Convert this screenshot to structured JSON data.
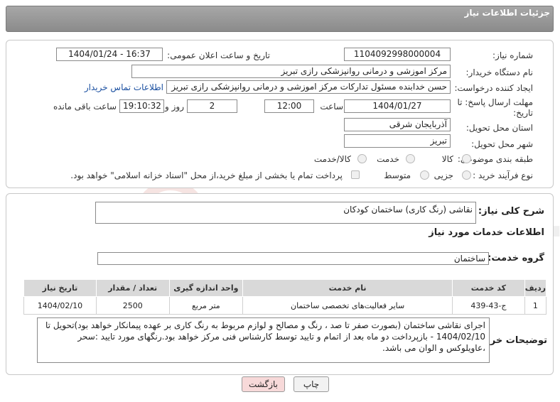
{
  "header": {
    "title": "جزئیات اطلاعات نیاز"
  },
  "fields": {
    "need_number_label": "شماره نیاز:",
    "need_number": "1104092998000004",
    "announce_label": "تاریخ و ساعت اعلان عمومی:",
    "announce_value": "1404/01/24 - 16:37",
    "buyer_org_label": "نام دستگاه خریدار:",
    "buyer_org": "مرکز اموزشی و درمانی روانپزشکی رازی تبریز",
    "creator_label": "ایجاد کننده درخواست:",
    "creator": "حسن خدابنده مسئول تدارکات مرکز اموزشی و درمانی روانپزشکی رازی تبریز",
    "contact_link": "اطلاعات تماس خریدار",
    "deadline_label": "مهلت ارسال پاسخ: تا تاریخ:",
    "deadline_date": "1404/01/27",
    "time_label": "ساعت",
    "deadline_time": "12:00",
    "days_value": "2",
    "days_label": "روز و",
    "remaining_time": "19:10:32",
    "remaining_label": "ساعت باقی مانده",
    "province_label": "استان محل تحویل:",
    "province": "آذربایجان شرقی",
    "city_label": "شهر محل تحویل:",
    "city": "تبریز",
    "category_label": "طبقه بندی موضوعی:",
    "category_options": [
      "کالا",
      "خدمت",
      "کالا/خدمت"
    ],
    "process_label": "نوع فرآیند خرید :",
    "process_options": [
      "جزیی",
      "متوسط"
    ],
    "payment_note": "پرداخت تمام یا بخشی از مبلغ خرید،از محل \"اسناد خزانه اسلامی\" خواهد بود."
  },
  "summary": {
    "label": "شرح کلی نیاز:",
    "value": "نقاشی (رنگ کاری) ساختمان کودکان"
  },
  "services": {
    "section_title": "اطلاعات خدمات مورد نیاز",
    "group_label": "گروه خدمت:",
    "group_value": "ساختمان",
    "columns": [
      "ردیف",
      "کد خدمت",
      "نام خدمت",
      "واحد اندازه گیری",
      "تعداد / مقدار",
      "تاریخ نیاز"
    ],
    "rows": [
      [
        "1",
        "ج-43-439",
        "سایر فعالیت‌های تخصصی ساختمان",
        "متر مربع",
        "2500",
        "1404/02/10"
      ]
    ]
  },
  "buyer_notes": {
    "label": "توضیحات خریدار:",
    "value": "اجرای نقاشی ساختمان (بصورت صفر تا صد ، رنگ و مصالح و لوازم مربوط به رنگ کاری بر عهده پیمانکار خواهد بود)تحویل تا 1404/02/10 - بازپرداخت دو ماه بعد از اتمام و تایید توسط کارشناس فنی مرکز خواهد بود.رنگهای مورد تایید :سحر ،عاویلوکس و الوان می باشد."
  },
  "buttons": {
    "print": "چاپ",
    "back": "بازگشت"
  },
  "watermark": "AriaTender.neT",
  "colors": {
    "header_bg": "#999999",
    "link": "#1a4fa0",
    "back_button": "#f7d9d9"
  }
}
